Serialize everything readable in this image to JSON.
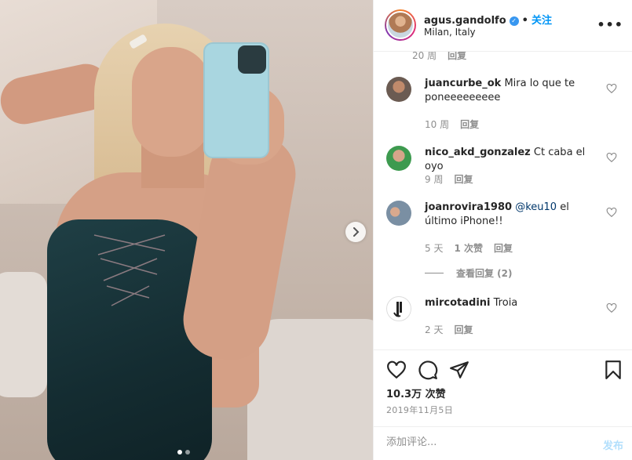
{
  "post": {
    "username": "agus.gandolfo",
    "separator": "•",
    "follow_label": "关注",
    "location": "Milan, Italy",
    "more_icon": "more-horizontal-icon",
    "verified_icon": "verified-badge-icon"
  },
  "carousel": {
    "next_icon": "chevron-right-icon",
    "slide_count": 2,
    "active_index": 0
  },
  "comments": [
    {
      "meta_time": "20 周",
      "meta_reply": "回复"
    },
    {
      "user": "juancurbe_ok",
      "text": "Mira lo que te poneeeeeeeee",
      "time": "10 周",
      "reply": "回复",
      "avatar_color": "#6b5b52"
    },
    {
      "user": "nico_akd_gonzalez",
      "text": "Ct caba el oyo",
      "time": "9 周",
      "reply": "回复",
      "avatar_color": "#3d9a4f"
    },
    {
      "user": "joanrovira1980",
      "mention": "@keu10",
      "text": "el último iPhone!!",
      "time": "5 天",
      "likes": "1 次赞",
      "reply": "回复",
      "view_replies": "查看回复 (2)",
      "avatar_color": "#7a8fa3"
    },
    {
      "user": "mircotadini",
      "text": "Troia",
      "time": "2 天",
      "reply": "回复",
      "avatar_color": "#222222"
    }
  ],
  "actions": {
    "like_icon": "heart-icon",
    "comment_icon": "comment-icon",
    "share_icon": "share-icon",
    "save_icon": "bookmark-icon"
  },
  "likes_label": "10.3万 次赞",
  "date": "2019年11月5日",
  "comment_box": {
    "placeholder": "添加评论...",
    "post_label": "发布"
  },
  "colors": {
    "accent": "#0095f6",
    "verified": "#3897f0",
    "muted": "#8e8e8e",
    "post_disabled": "#b2dffc"
  }
}
